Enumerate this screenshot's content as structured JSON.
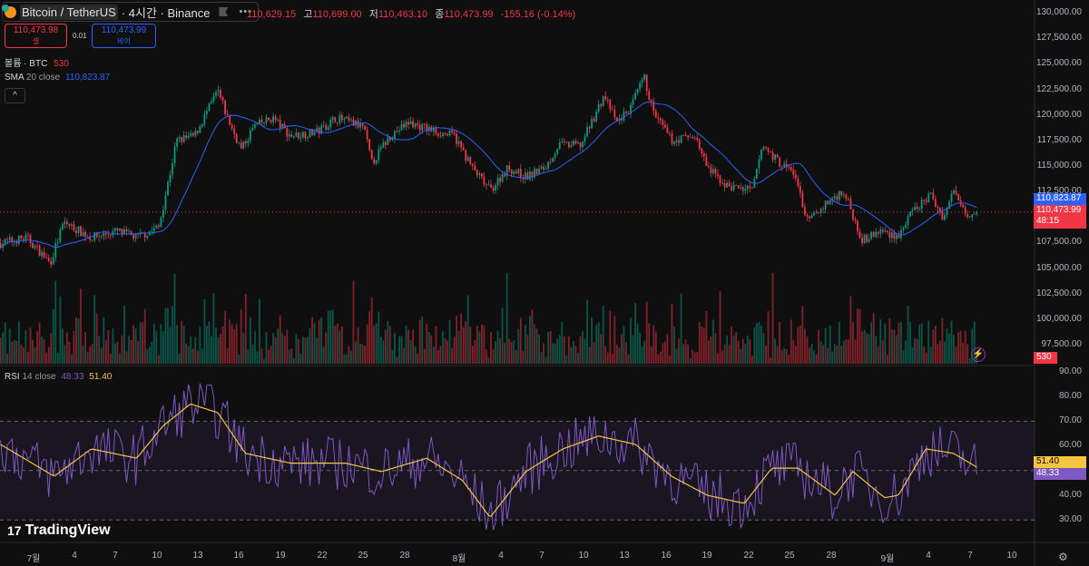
{
  "header": {
    "symbol": "Bitcoin / TetherUS",
    "timeframe": "· 4시간 · Binance",
    "more": "•••",
    "open_label": "",
    "open": "110,629.15",
    "high_label": "고",
    "high": "110,699.00",
    "low_label": "저",
    "low": "110,463.10",
    "close_label": "종",
    "close": "110,473.99",
    "change": "-155.16 (-0.14%)"
  },
  "trade": {
    "sell_price": "110,473.98",
    "sell_label": "셀",
    "spread": "0.01",
    "buy_price": "110,473.99",
    "buy_label": "바이"
  },
  "indicators": {
    "volume_label": "볼륨 · BTC",
    "volume_value": "530",
    "sma_label": "SMA",
    "sma_params": "20 close",
    "sma_value": "110,823.87",
    "rsi_label": "RSI",
    "rsi_params": "14 close",
    "rsi_value": "48.33",
    "rsi_ma_value": "51.40"
  },
  "collapse_icon": "chevron-up-icon",
  "price_axis": [
    "130,000.00",
    "127,500.00",
    "125,000.00",
    "122,500.00",
    "120,000.00",
    "117,500.00",
    "115,000.00",
    "112,500.00",
    "107,500.00",
    "105,000.00",
    "102,500.00",
    "100,000.00",
    "97,500.00"
  ],
  "rsi_axis": [
    "90.00",
    "80.00",
    "70.00",
    "60.00",
    "40.00",
    "30.00"
  ],
  "tags": {
    "sma": "110,823.87",
    "last": "110,473.99",
    "countdown": "48:15",
    "volume": "530",
    "rsi_ma": "51.40",
    "rsi": "48.33"
  },
  "x_axis": [
    "7월",
    "4",
    "7",
    "10",
    "13",
    "16",
    "19",
    "22",
    "25",
    "28",
    "8월",
    "4",
    "7",
    "10",
    "13",
    "16",
    "19",
    "22",
    "25",
    "28",
    "9월",
    "4",
    "7",
    "10"
  ],
  "logo": "TradingView",
  "colors": {
    "up": "#089981",
    "down": "#f23645",
    "sma": "#2962ff",
    "rsi": "#7e57c2",
    "rsi_ma": "#f5c542",
    "bg": "#0f0f0f"
  },
  "chart_data": {
    "type": "candlestick",
    "interval": "4h",
    "x_unit": "days since Jul 1",
    "price_keypoints": [
      [
        -2.4,
        107443
      ],
      [
        -0.5,
        107975
      ],
      [
        1.2,
        105488
      ],
      [
        2.2,
        109485
      ],
      [
        4.2,
        107975
      ],
      [
        6.1,
        108597
      ],
      [
        7.5,
        107975
      ],
      [
        9.1,
        109000
      ],
      [
        9.8,
        113481
      ],
      [
        10.4,
        117478
      ],
      [
        11.7,
        117922
      ],
      [
        13.4,
        122362
      ],
      [
        14.1,
        119698
      ],
      [
        15.1,
        116589
      ],
      [
        16.0,
        118810
      ],
      [
        17.4,
        119698
      ],
      [
        18.7,
        117922
      ],
      [
        20.7,
        118366
      ],
      [
        22.0,
        119698
      ],
      [
        24.0,
        118810
      ],
      [
        24.6,
        115257
      ],
      [
        25.9,
        117922
      ],
      [
        27.3,
        119254
      ],
      [
        29.2,
        118366
      ],
      [
        30.6,
        117922
      ],
      [
        31.9,
        114813
      ],
      [
        33.2,
        112593
      ],
      [
        34.5,
        114813
      ],
      [
        35.8,
        113925
      ],
      [
        37.2,
        114813
      ],
      [
        38.2,
        117034
      ],
      [
        39.8,
        117034
      ],
      [
        41.5,
        121918
      ],
      [
        42.4,
        119254
      ],
      [
        43.4,
        120586
      ],
      [
        44.4,
        123694
      ],
      [
        45.1,
        120142
      ],
      [
        46.4,
        117478
      ],
      [
        48.1,
        117922
      ],
      [
        49.0,
        114813
      ],
      [
        50.4,
        113037
      ],
      [
        52.3,
        112593
      ],
      [
        53.0,
        117034
      ],
      [
        54.3,
        115257
      ],
      [
        55.3,
        114369
      ],
      [
        56.3,
        109485
      ],
      [
        57.6,
        111261
      ],
      [
        58.9,
        112593
      ],
      [
        60.3,
        107709
      ],
      [
        61.6,
        108597
      ],
      [
        62.9,
        108153
      ],
      [
        63.9,
        110373
      ],
      [
        65.2,
        112149
      ],
      [
        66.2,
        109929
      ],
      [
        66.9,
        112593
      ],
      [
        67.9,
        110373
      ],
      [
        68.6,
        110474
      ]
    ],
    "rsi_ma_keypoints": [
      [
        -2.4,
        60.6
      ],
      [
        1.5,
        47.7
      ],
      [
        4.2,
        58.8
      ],
      [
        7.5,
        55
      ],
      [
        9.4,
        68
      ],
      [
        11.4,
        77
      ],
      [
        13.4,
        73.5
      ],
      [
        15.4,
        57
      ],
      [
        18.7,
        53
      ],
      [
        22.7,
        53
      ],
      [
        25.3,
        49.6
      ],
      [
        28.6,
        55
      ],
      [
        31.2,
        46
      ],
      [
        33.2,
        31
      ],
      [
        35.8,
        49.6
      ],
      [
        38.5,
        58.8
      ],
      [
        41.1,
        64
      ],
      [
        43.8,
        60.6
      ],
      [
        46.4,
        47.7
      ],
      [
        49.0,
        40
      ],
      [
        51.7,
        36.7
      ],
      [
        53.7,
        51
      ],
      [
        55.6,
        51
      ],
      [
        58.3,
        40
      ],
      [
        59.6,
        49.6
      ],
      [
        61.9,
        39
      ],
      [
        62.9,
        40
      ],
      [
        64.9,
        58.8
      ],
      [
        66.9,
        57
      ],
      [
        68.6,
        51.4
      ]
    ],
    "price_range": [
      97500,
      130000
    ],
    "rsi_range": [
      30,
      90
    ],
    "rsi_bands": [
      70,
      50,
      30
    ]
  }
}
